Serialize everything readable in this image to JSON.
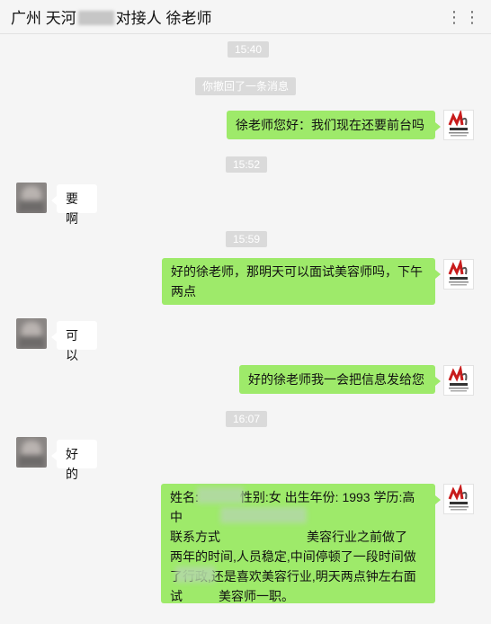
{
  "header": {
    "title_prefix": "广州  天河",
    "title_suffix": "对接人 徐老师",
    "more_icon": "⋮⋮"
  },
  "timestamps": [
    "15:40",
    "15:52",
    "15:59",
    "16:07"
  ],
  "recall_notice": "你撤回了一条消息",
  "messages": [
    {
      "side": "right",
      "text": "徐老师您好：我们现在还要前台吗"
    },
    {
      "side": "left",
      "text": "要啊"
    },
    {
      "side": "right",
      "line1": "好的徐老师，那明天可以面试美容师吗，下午",
      "line2": "两点"
    },
    {
      "side": "left",
      "text": "可以"
    },
    {
      "side": "right",
      "text": "好的徐老师我一会把信息发给您"
    },
    {
      "side": "left",
      "text": "好的"
    },
    {
      "side": "right",
      "line1a": "姓名:",
      "line1b": "性别:女 出生年份: 1993 学历:高中",
      "line2a": "联系方式",
      "line2b": "美容行业之前做了",
      "line3": "两年的时间,人员稳定,中间停顿了一段时间做",
      "line4": "了行政,还是喜欢美容行业,明天两点钟左右面",
      "line5a": "试",
      "line5b": "美容师一职。"
    }
  ],
  "colors": {
    "sent_bubble": "#9eea6a",
    "received_bubble": "#ffffff",
    "background": "#f5f5f5"
  }
}
